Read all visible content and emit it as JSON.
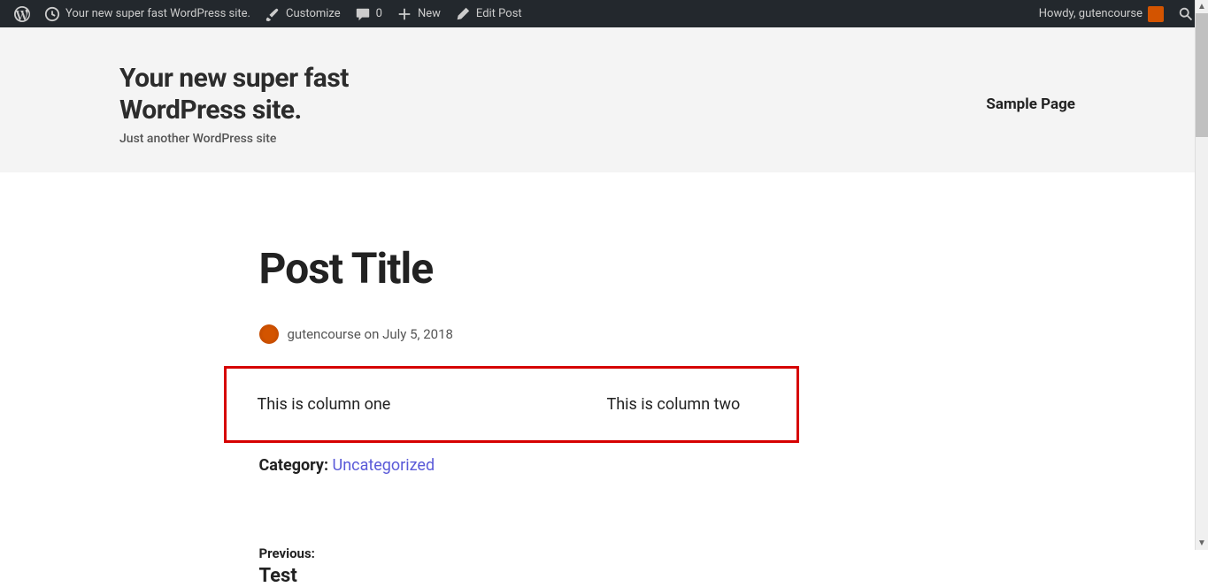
{
  "adminbar": {
    "site_name": "Your new super fast WordPress site.",
    "customize": "Customize",
    "comments_count": "0",
    "new": "New",
    "edit_post": "Edit Post",
    "howdy": "Howdy, gutencourse"
  },
  "header": {
    "site_title": "Your new super fast WordPress site.",
    "tagline": "Just another WordPress site",
    "nav_item": "Sample Page"
  },
  "post": {
    "title": "Post Title",
    "author": "gutencourse",
    "on": "on",
    "date": "July 5, 2018",
    "col1": "This is column one",
    "col2": "This is column two",
    "category_label": "Category:",
    "category_link": "Uncategorized"
  },
  "nav": {
    "prev_label": "Previous:",
    "prev_title": "Test"
  }
}
